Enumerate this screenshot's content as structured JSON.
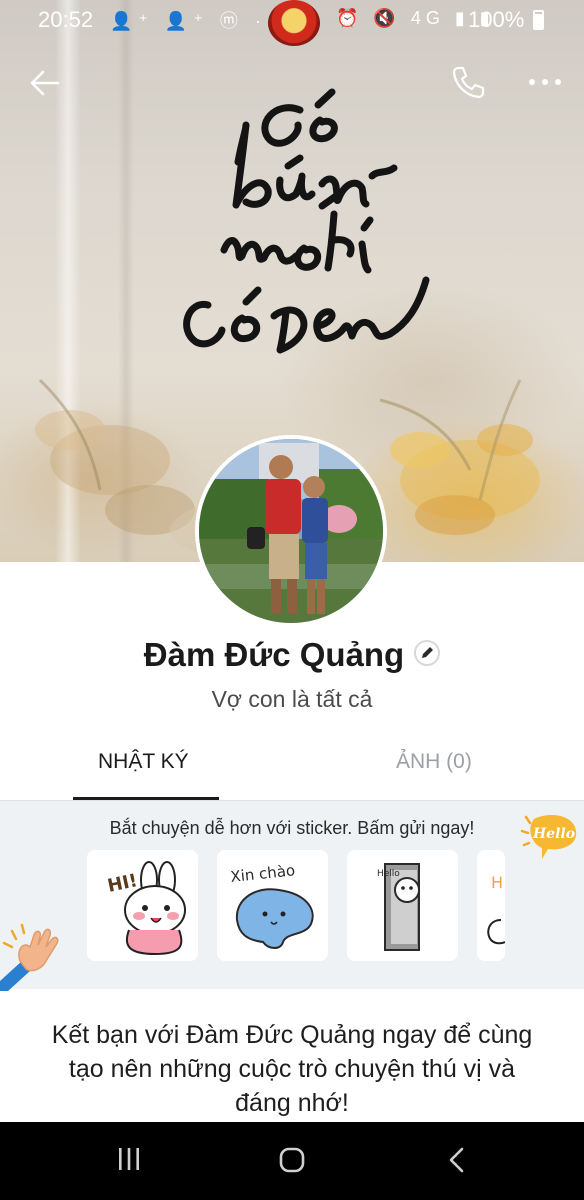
{
  "status_bar": {
    "time": "20:52",
    "left_icons": "👤⁺ 👤⁺ ⓜ ·",
    "right_icons": "⏰ 🔇 4G ▮ ▮",
    "battery": "100%"
  },
  "top_bar": {
    "back_icon": "arrow-left-icon",
    "call_icon": "phone-icon",
    "more_icon": "more-dots-icon"
  },
  "cover": {
    "description_icon": "calligraphy-cover-image"
  },
  "profile": {
    "name": "Đàm Đức Quảng",
    "status": "Vợ con là tất cả"
  },
  "tabs": [
    {
      "label": "NHẬT KÝ",
      "active": true
    },
    {
      "label": "ẢNH (0)",
      "active": false
    }
  ],
  "sticker_section": {
    "prompt": "Bắt chuyện dễ hơn với sticker. Bấm gửi ngay!",
    "badge": "Hello",
    "stickers": [
      {
        "name": "bunny-hi",
        "text": "HI!"
      },
      {
        "name": "elephant-xin-chao",
        "text": "Xin chào"
      },
      {
        "name": "bear-door-hello",
        "text": "Hello"
      },
      {
        "name": "partial-sticker",
        "text": "H"
      }
    ]
  },
  "cta": {
    "text": "Kết bạn với Đàm Đức Quảng ngay để cùng tạo nên những cuộc trò chuyện thú vị và đáng nhớ!"
  },
  "colors": {
    "accent": "#1b1b1b",
    "tab_inactive": "#9aa1a8",
    "sticker_bg": "#eef2f5",
    "nav_bg": "#000000"
  }
}
